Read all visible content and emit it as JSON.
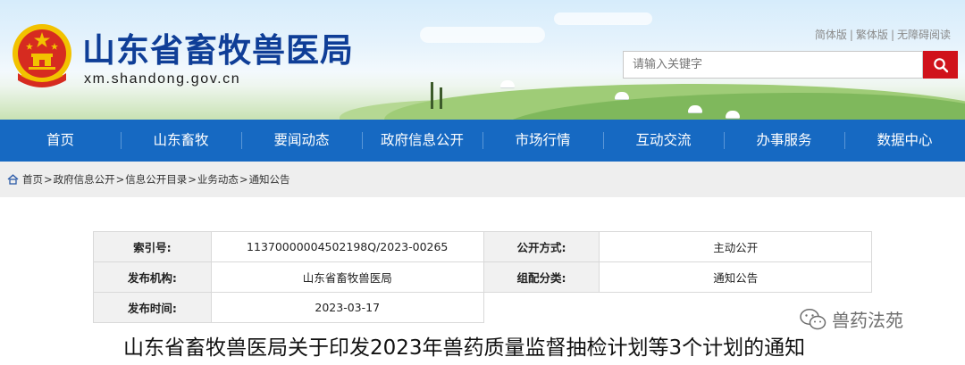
{
  "header": {
    "site_title": "山东省畜牧兽医局",
    "domain": "xm.shandong.gov.cn",
    "lang_links": [
      "简体版",
      "繁体版",
      "无障碍阅读"
    ],
    "search": {
      "placeholder": "请输入关键字"
    }
  },
  "nav": [
    "首页",
    "山东畜牧",
    "要闻动态",
    "政府信息公开",
    "市场行情",
    "互动交流",
    "办事服务",
    "数据中心"
  ],
  "breadcrumb": [
    "首页",
    "政府信息公开",
    "信息公开目录",
    "业务动态",
    "通知公告"
  ],
  "info": {
    "index_label": "索引号:",
    "index_value": "11370000004502198Q/2023-00265",
    "disclosure_label": "公开方式:",
    "disclosure_value": "主动公开",
    "issuer_label": "发布机构:",
    "issuer_value": "山东省畜牧兽医局",
    "category_label": "组配分类:",
    "category_value": "通知公告",
    "date_label": "发布时间:",
    "date_value": "2023-03-17"
  },
  "document": {
    "title": "山东省畜牧兽医局关于印发2023年兽药质量监督抽检计划等3个计划的通知"
  },
  "watermark": {
    "text": "兽药法苑",
    "icon": "wechat-icon"
  },
  "colors": {
    "nav_bg": "#1669c2",
    "title_blue": "#0f3e97",
    "search_red": "#d0121b",
    "emblem_red": "#d62b20",
    "emblem_gold": "#f2c200"
  }
}
